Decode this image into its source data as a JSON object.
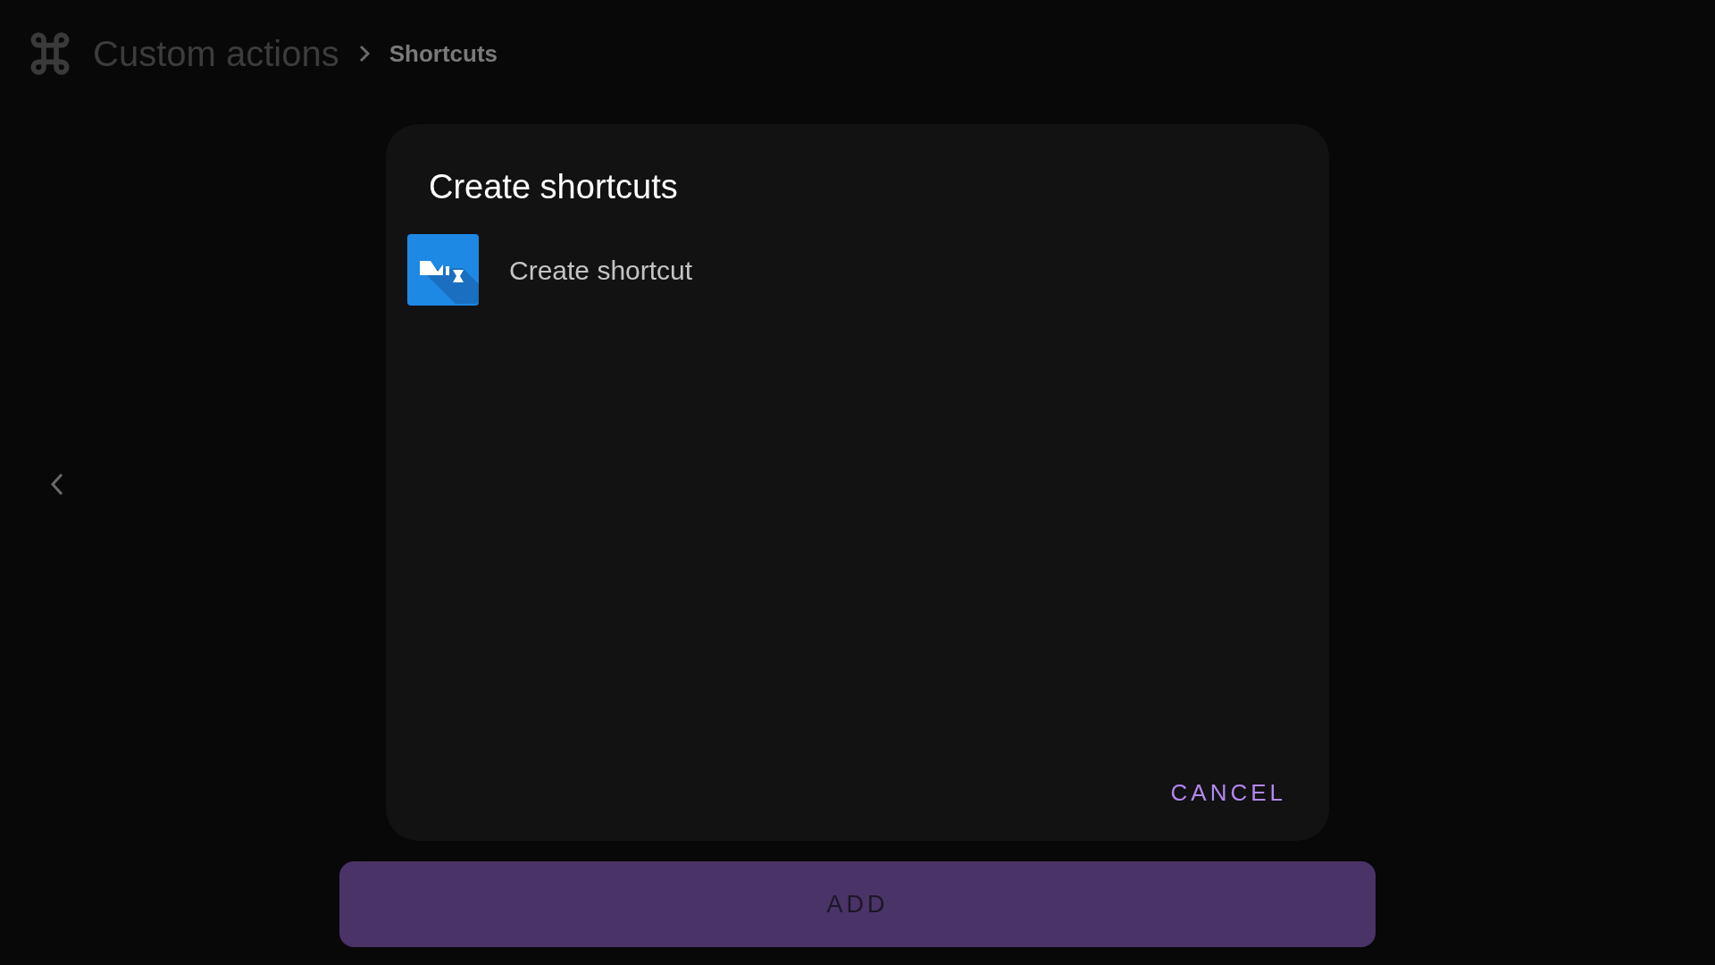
{
  "header": {
    "title": "Custom actions",
    "subtitle": "Shortcuts"
  },
  "dialog": {
    "title": "Create shortcuts",
    "items": [
      {
        "label": "Create shortcut"
      }
    ],
    "buttons": [
      "CANCEL"
    ]
  },
  "add_button": "ADD"
}
